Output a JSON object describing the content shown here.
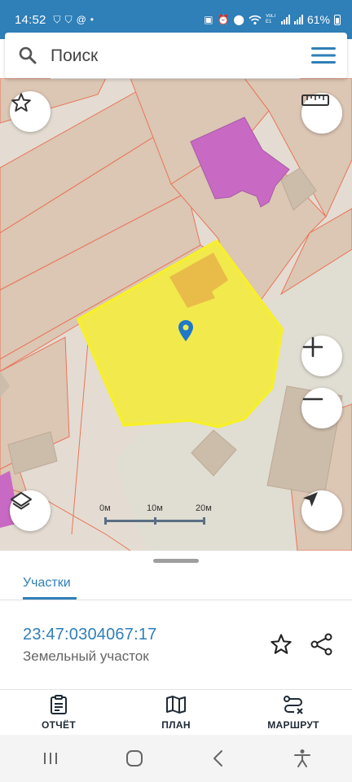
{
  "status_bar": {
    "time": "14:52",
    "battery": "61%",
    "lte_label": "VoLTE1"
  },
  "search": {
    "placeholder": "Поиск"
  },
  "map": {
    "scale_labels": [
      "0м",
      "10м",
      "20м"
    ],
    "colors": {
      "background": "#e4dcd2",
      "parcel_fill": "#dcc6b4",
      "parcel_border": "#e8765a",
      "selected_parcel_fill": "#f2e94d",
      "selected_parcel_border": "#f7f02a",
      "building_purple": "#c86ac4",
      "building_orange": "#e8b44a",
      "building_gray": "#ccbcaa",
      "marker": "#1f78c8"
    },
    "controls": [
      "star-icon",
      "ruler-icon",
      "zoom-in-icon",
      "zoom-out-icon",
      "layers-icon",
      "navigation-arrow-icon"
    ]
  },
  "sheet": {
    "tab_label": "Участки",
    "parcel_number": "23:47:0304067:17",
    "parcel_type": "Земельный участок"
  },
  "actions": [
    {
      "label": "ОТЧЁТ",
      "icon": "report-icon"
    },
    {
      "label": "ПЛАН",
      "icon": "map-plan-icon"
    },
    {
      "label": "МАРШРУТ",
      "icon": "route-icon"
    }
  ],
  "accent_color": "#2f7fb8"
}
